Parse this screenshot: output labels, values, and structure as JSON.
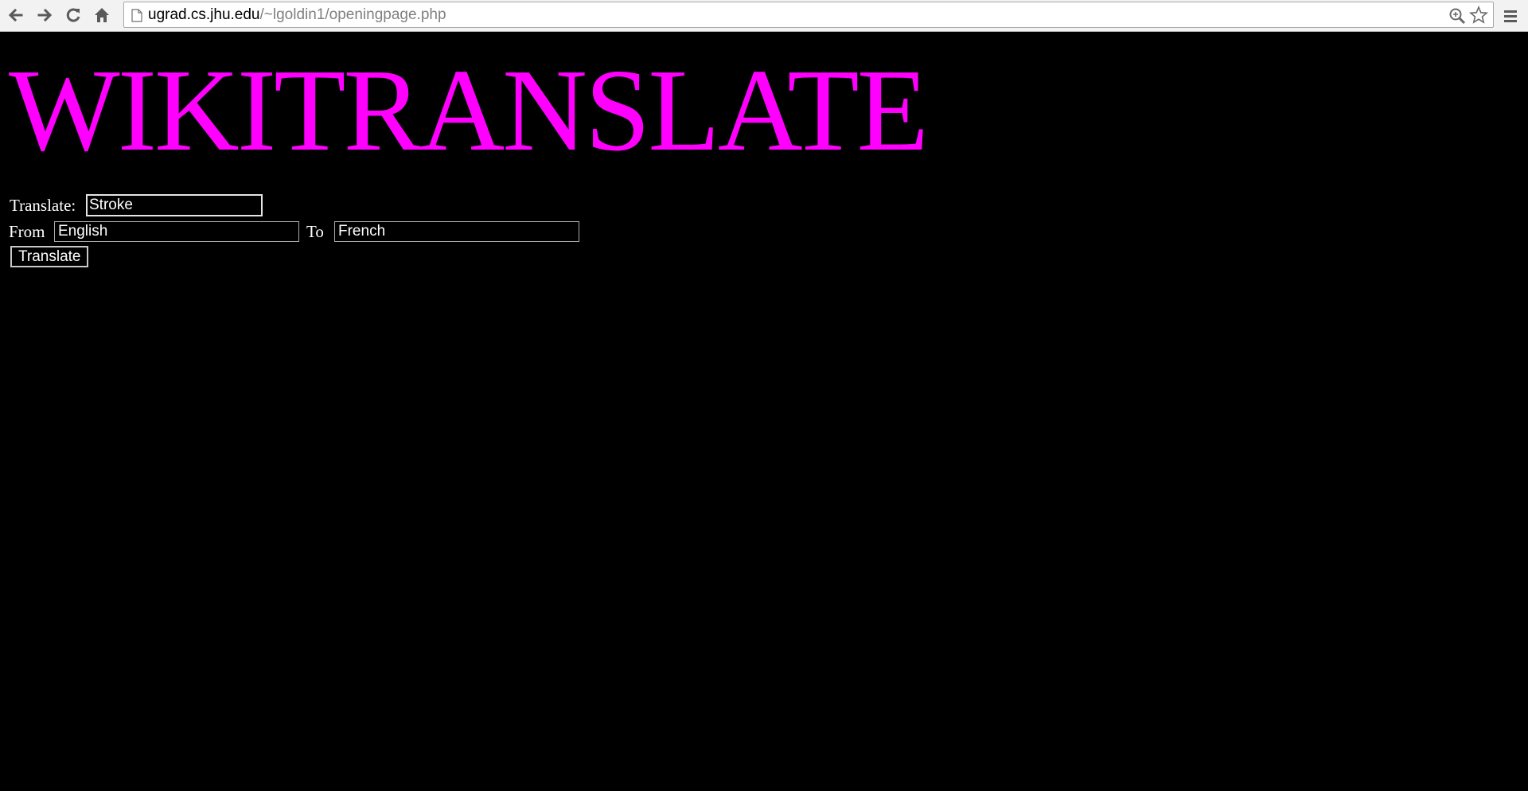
{
  "browser": {
    "url_host": "ugrad.cs.jhu.edu",
    "url_path": "/~lgoldin1/openingpage.php"
  },
  "page": {
    "title": "WIKITRANSLATE",
    "translate_label": "Translate:",
    "translate_value": "Stroke",
    "from_label": "From",
    "from_value": "English",
    "to_label": "To",
    "to_value": "French",
    "submit_label": "Translate"
  },
  "colors": {
    "background": "#000000",
    "title": "#ff00ff",
    "text": "#ffffff"
  },
  "icons": [
    "back-icon",
    "forward-icon",
    "reload-icon",
    "home-icon",
    "page-icon",
    "zoom-icon",
    "star-icon",
    "menu-icon"
  ]
}
